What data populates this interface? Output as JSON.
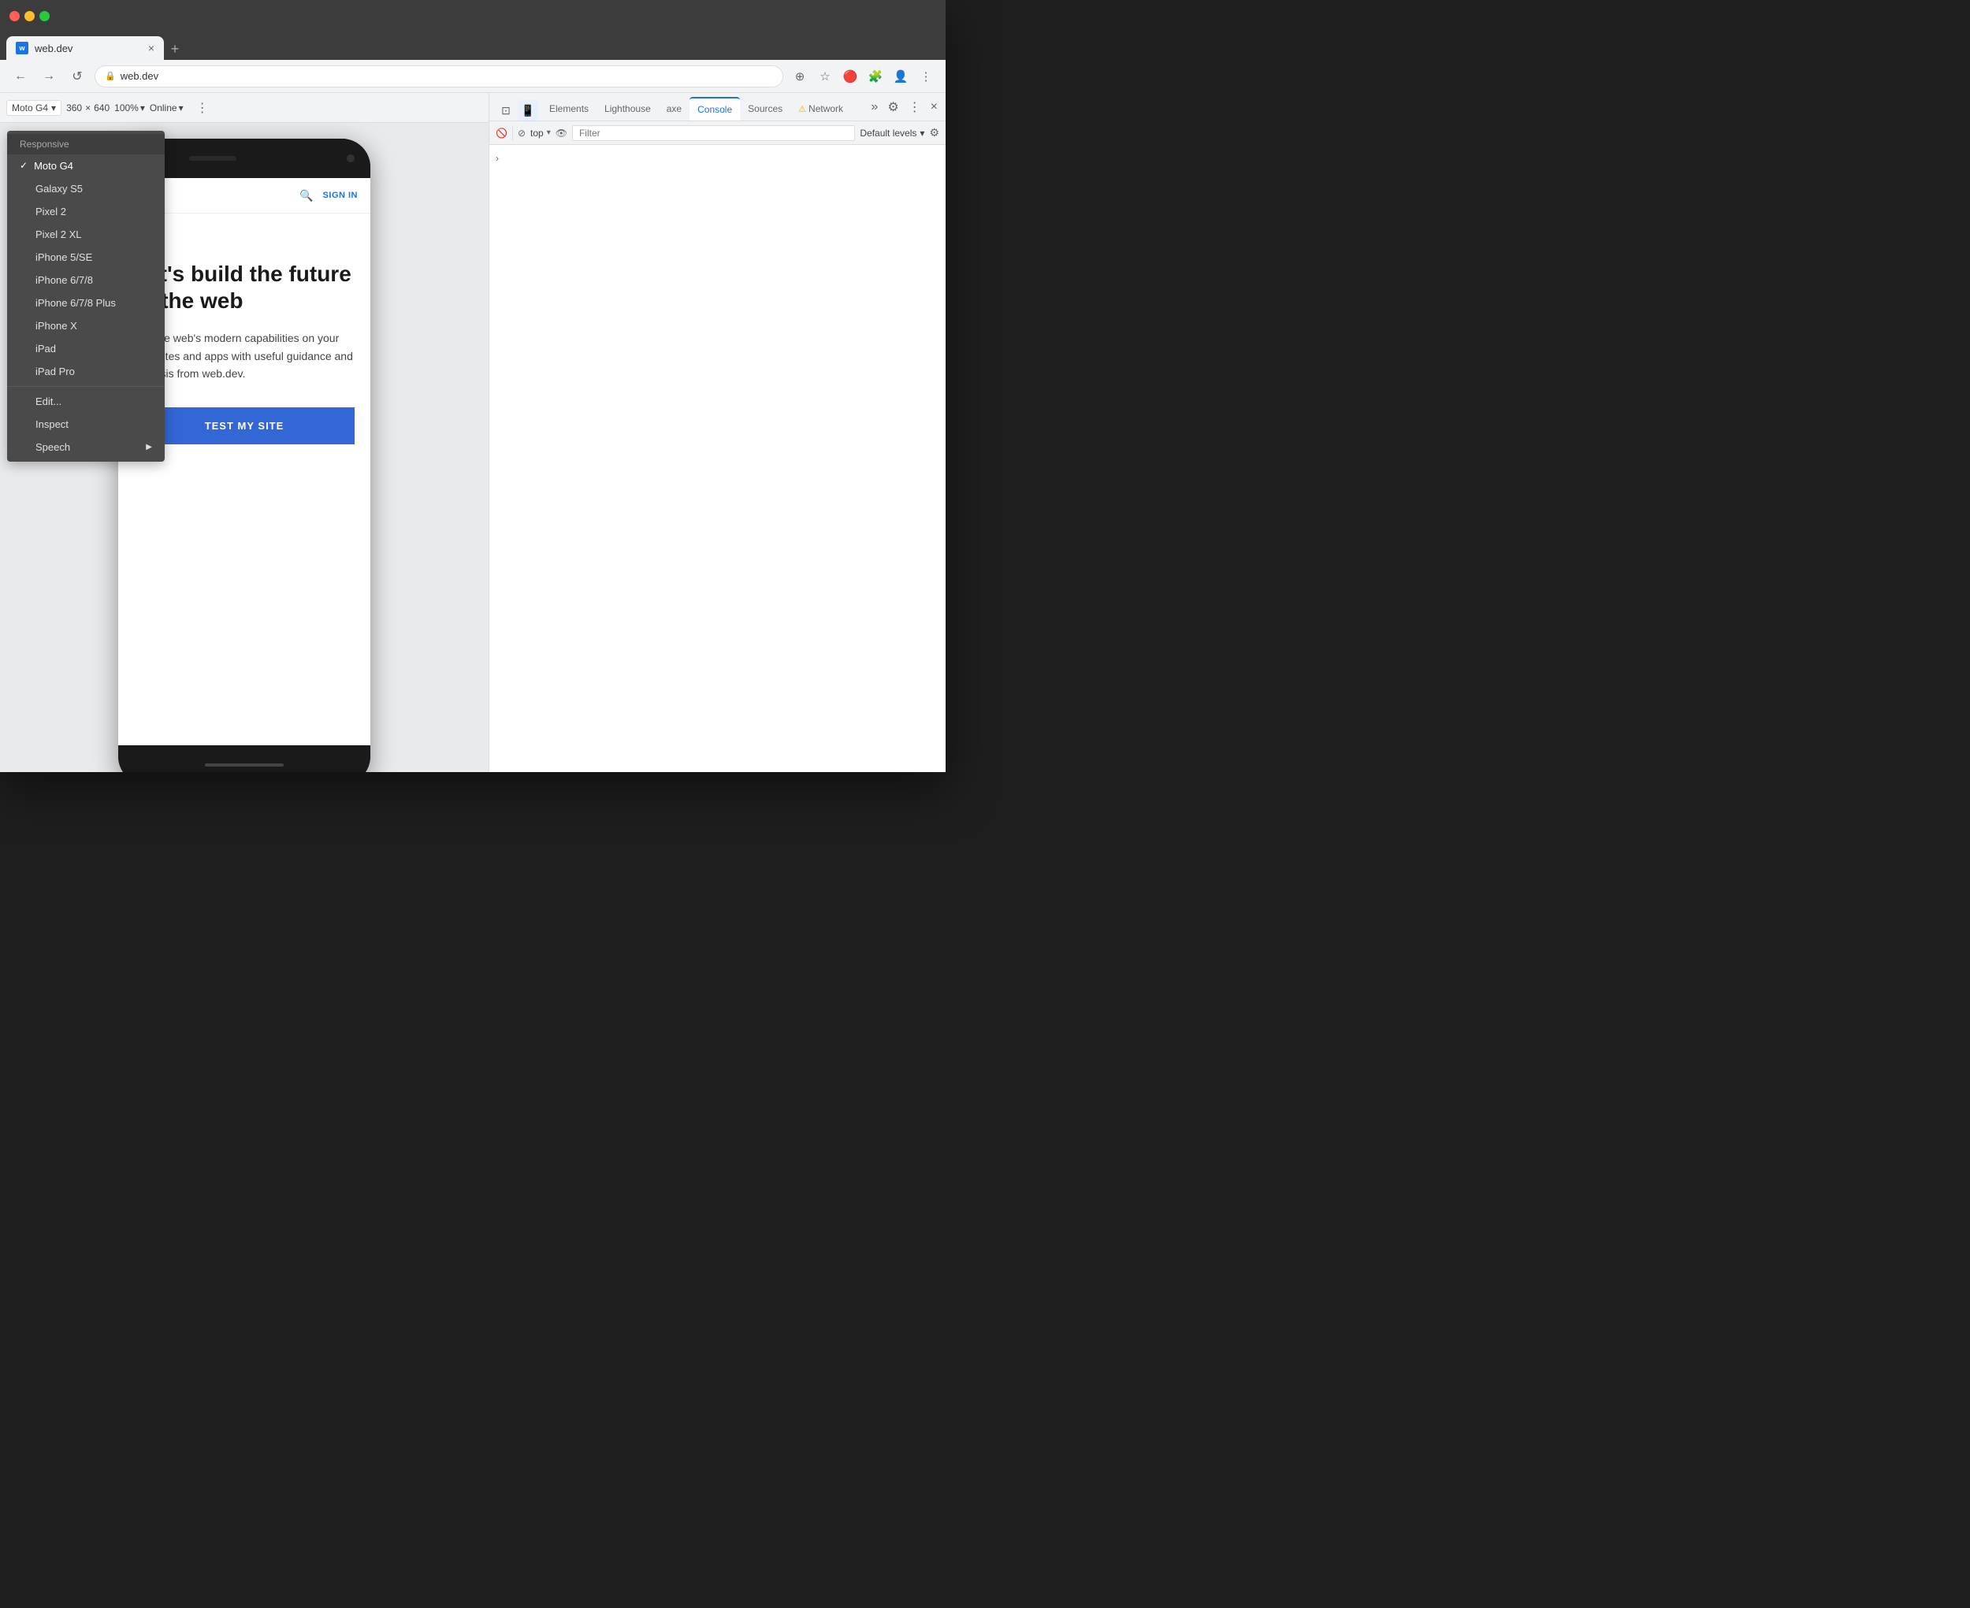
{
  "window": {
    "title": "web.dev",
    "tab_label": "web.dev",
    "url": "web.dev"
  },
  "traffic_lights": {
    "red": "red",
    "yellow": "yellow",
    "green": "green"
  },
  "tab_bar": {
    "new_tab_label": "+"
  },
  "address_bar": {
    "url": "web.dev",
    "back_label": "←",
    "forward_label": "→",
    "reload_label": "↺"
  },
  "device_toolbar": {
    "device_name": "Moto G4",
    "width": "360",
    "height": "640",
    "zoom": "100%",
    "connectivity": "Online",
    "more_options_label": "⋮"
  },
  "dropdown_menu": {
    "header_label": "Responsive",
    "items": [
      {
        "label": "Moto G4",
        "active": true
      },
      {
        "label": "Galaxy S5",
        "active": false
      },
      {
        "label": "Pixel 2",
        "active": false
      },
      {
        "label": "Pixel 2 XL",
        "active": false
      },
      {
        "label": "iPhone 5/SE",
        "active": false
      },
      {
        "label": "iPhone 6/7/8",
        "active": false
      },
      {
        "label": "iPhone 6/7/8 Plus",
        "active": false
      },
      {
        "label": "iPhone X",
        "active": false
      },
      {
        "label": "iPad",
        "active": false
      },
      {
        "label": "iPad Pro",
        "active": false
      }
    ],
    "actions": [
      {
        "label": "Edit...",
        "separator_before": true
      },
      {
        "label": "Inspect",
        "has_arrow": false
      },
      {
        "label": "Speech",
        "has_arrow": true
      }
    ]
  },
  "site": {
    "header": {
      "sign_in_label": "SIGN IN"
    },
    "hero": {
      "title": "Let's build the future of the web",
      "description": "Get the web's modern capabilities on your own sites and apps with useful guidance and analysis from web.dev.",
      "cta_label": "TEST MY SITE"
    }
  },
  "devtools": {
    "tabs": [
      {
        "label": "Elements",
        "active": false
      },
      {
        "label": "Lighthouse",
        "active": false
      },
      {
        "label": "axe",
        "active": false
      },
      {
        "label": "Console",
        "active": true
      },
      {
        "label": "Sources",
        "active": false
      },
      {
        "label": "Network",
        "active": false,
        "warning": true
      }
    ],
    "console_bar": {
      "context": "top",
      "filter_placeholder": "Filter",
      "level_selector": "Default levels"
    },
    "chevron": "›"
  }
}
